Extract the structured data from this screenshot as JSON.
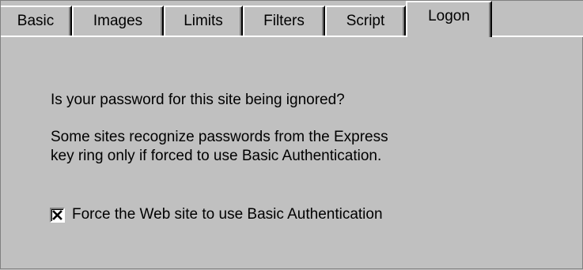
{
  "tabs": [
    {
      "label": "Basic"
    },
    {
      "label": "Images"
    },
    {
      "label": "Limits"
    },
    {
      "label": "Filters"
    },
    {
      "label": "Script"
    },
    {
      "label": "Logon",
      "active": true
    }
  ],
  "logon": {
    "question": "Is your password for this site being ignored?",
    "explanation_line1": "Some sites recognize passwords from the Express",
    "explanation_line2": "key ring only if forced to use Basic Authentication.",
    "checkbox_label": "Force the Web site to use Basic Authentication",
    "checkbox_checked": true
  }
}
